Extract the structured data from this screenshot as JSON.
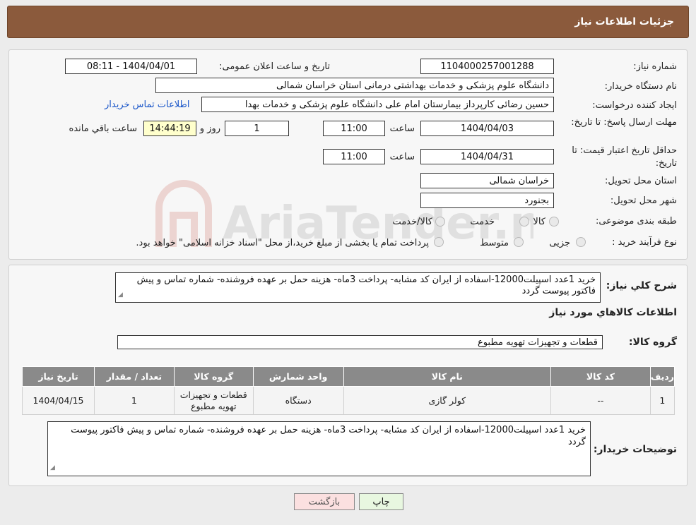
{
  "header": {
    "title": "جزئیات اطلاعات نیاز"
  },
  "labels": {
    "need_number": "شماره نیاز:",
    "announce_datetime": "تاریخ و ساعت اعلان عمومی:",
    "buyer_org": "نام دستگاه خریدار:",
    "requester": "ایجاد کننده درخواست:",
    "reply_deadline": "مهلت ارسال پاسخ: تا تاریخ:",
    "price_validity": "حداقل تاریخ اعتبار قیمت: تا تاریخ:",
    "time": "ساعت",
    "day_and": "روز و",
    "remaining": "ساعت باقي مانده",
    "province": "استان محل تحویل:",
    "city": "شهر محل تحویل:",
    "category": "طبقه بندی موضوعی:",
    "purchase_type": "نوع فرآیند خرید :",
    "need_summary": "شرح کلي نياز:",
    "goods_info": "اطلاعات کالاهاي مورد نياز",
    "goods_group": "گروه کالا:",
    "buyer_notes": "توضیحات خریدار:"
  },
  "fields": {
    "need_number": "1104000257001288",
    "announce_datetime": "1404/04/01 - 08:11",
    "buyer_org": "دانشگاه علوم پزشکی و خدمات بهداشتی درمانی استان خراسان شمالی",
    "requester": "حسین رضائی کارپرداز بیمارستان امام علی دانشگاه علوم پزشکی و خدمات بهدا",
    "contact_link": "اطلاعات تماس خریدار",
    "reply_date": "1404/04/03",
    "reply_time": "11:00",
    "reply_days": "1",
    "reply_remaining": "14:44:19",
    "validity_date": "1404/04/31",
    "validity_time": "11:00",
    "province": "خراسان شمالی",
    "city": "بجنورد"
  },
  "category_options": [
    "کالا",
    "خدمت",
    "کالا/خدمت"
  ],
  "purchase_options": [
    "جزیی",
    "متوسط"
  ],
  "purchase_note": "پرداخت تمام یا بخشی از مبلغ خرید،از محل \"اسناد خزانه اسلامی\" خواهد بود.",
  "need_summary": "خرید 1عدد اسپیلت12000-اسفاده از ایران کد مشابه- پرداخت 3ماه- هزینه حمل بر عهده فروشنده- شماره تماس و پیش فاکتور پیوست گردد",
  "goods_group": "قطعات و تجهیزات تهویه مطبوع",
  "table": {
    "headers": [
      "ردیف",
      "کد کالا",
      "نام کالا",
      "واحد شمارش",
      "گروه کالا",
      "تعداد / مقدار",
      "تاریخ نیاز"
    ],
    "rows": [
      [
        "1",
        "--",
        "کولر گازی",
        "دستگاه",
        "قطعات و تجهیزات تهویه مطبوع",
        "1",
        "1404/04/15"
      ]
    ]
  },
  "buyer_notes": "خرید 1عدد اسپیلت12000-اسفاده از ایران کد مشابه- پرداخت 3ماه- هزینه حمل بر عهده فروشنده- شماره تماس و پیش فاکتور پیوست گردد",
  "buttons": {
    "print": "چاپ",
    "back": "بازگشت"
  },
  "watermark": "AriaTender.neT",
  "colors": {
    "header_bg": "#8b5a3c",
    "link": "#1a56c9",
    "print_btn": "#e8f7e0",
    "back_btn": "#fbe0e0"
  }
}
